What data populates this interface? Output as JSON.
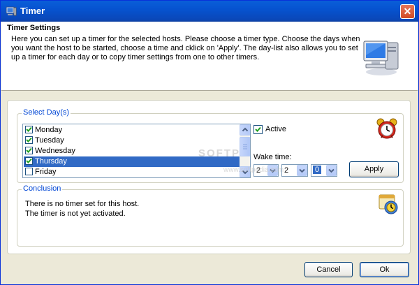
{
  "window": {
    "title": "Timer"
  },
  "header": {
    "title": "Timer Settings",
    "description": "Here you can set up a timer for the selected hosts. Please choose a timer type. Choose the days when you want the host to be started, choose a time and cklick on 'Apply'. The day-list also allows you to set up a timer for each day or to copy timer settings from one to other timers."
  },
  "days": {
    "legend": "Select Day(s)",
    "items": [
      {
        "label": "Monday",
        "checked": true,
        "selected": false
      },
      {
        "label": "Tuesday",
        "checked": true,
        "selected": false
      },
      {
        "label": "Wednesday",
        "checked": true,
        "selected": false
      },
      {
        "label": "Thursday",
        "checked": true,
        "selected": true
      },
      {
        "label": "Friday",
        "checked": false,
        "selected": false
      }
    ],
    "active_label": "Active",
    "active_checked": true,
    "wake_label": "Wake time:",
    "hour": "2",
    "minute": "2",
    "second": "0",
    "apply_label": "Apply"
  },
  "conclusion": {
    "legend": "Conclusion",
    "line1": "There is no timer set for this host.",
    "line2": "The timer is not yet activated."
  },
  "buttons": {
    "cancel": "Cancel",
    "ok": "Ok"
  },
  "watermark": {
    "main": "SOFTP",
    "sub": "www.softpedia.com"
  },
  "colors": {
    "titlebar": "#0a5fd8",
    "selection": "#316ac5",
    "legend": "#0046d5",
    "close": "#d24a24"
  },
  "icons": {
    "title": "monitor-icon",
    "header": "computer-icon",
    "days": "alarm-clock-icon",
    "conclusion": "timer-icon",
    "close": "close-icon"
  }
}
